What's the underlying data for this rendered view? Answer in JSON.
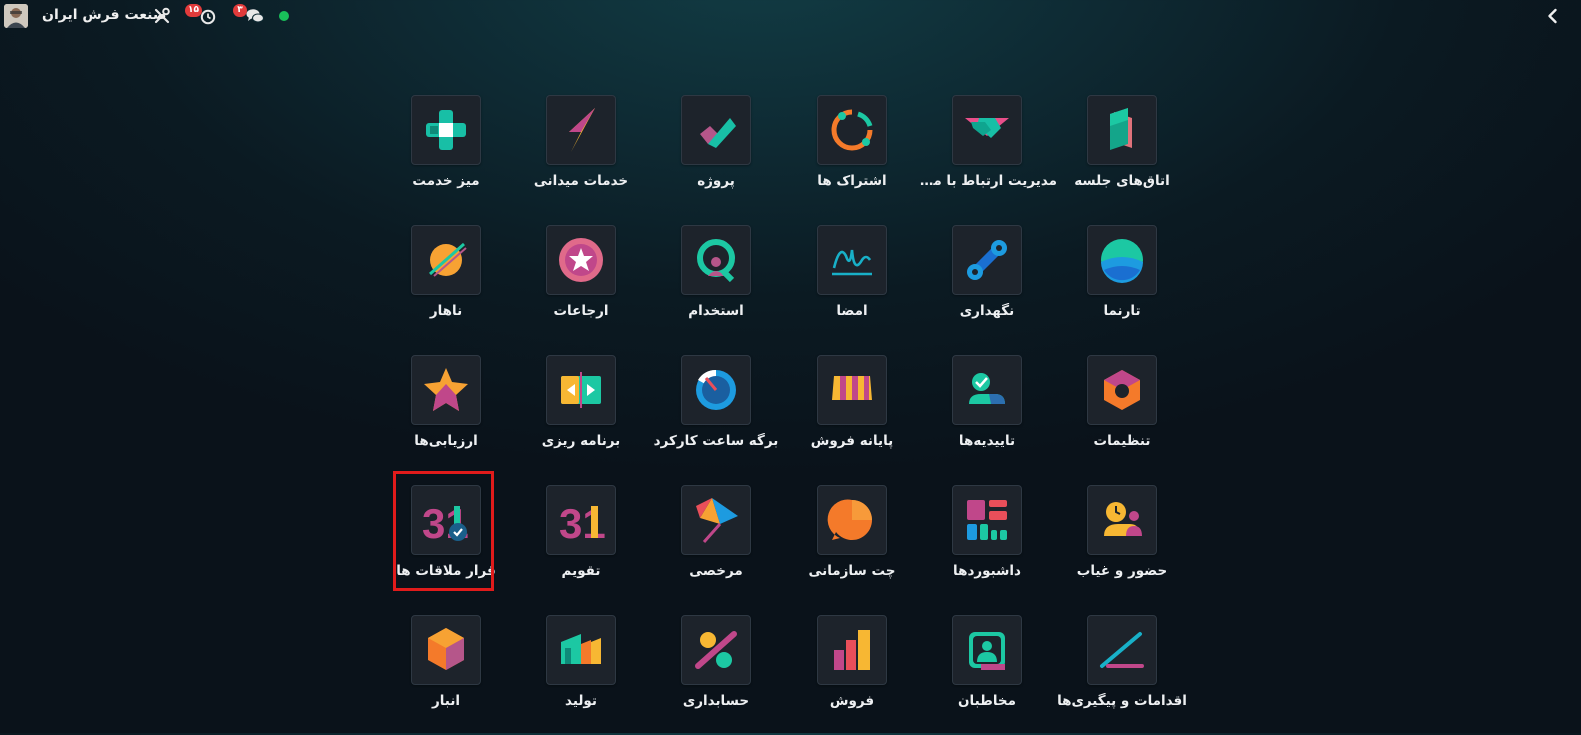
{
  "topbar": {
    "company": "صنعت فرش ایران",
    "activity_badge": "۱۵",
    "messages_badge": "۳",
    "status_color": "#19c15a"
  },
  "apps": [
    {
      "label": "اتاق‌های جلسه",
      "icon": "meeting-rooms-icon"
    },
    {
      "label": "مدیریت ارتباط با مشتری",
      "icon": "crm-icon"
    },
    {
      "label": "اشتراک ها",
      "icon": "subscriptions-icon"
    },
    {
      "label": "پروژه",
      "icon": "project-icon"
    },
    {
      "label": "خدمات میدانی",
      "icon": "field-service-icon"
    },
    {
      "label": "میز خدمت",
      "icon": "helpdesk-icon"
    },
    {
      "label": "تارنما",
      "icon": "website-icon"
    },
    {
      "label": "نگهداری",
      "icon": "maintenance-icon"
    },
    {
      "label": "امضا",
      "icon": "sign-icon"
    },
    {
      "label": "استخدام",
      "icon": "recruitment-icon"
    },
    {
      "label": "ارجاعات",
      "icon": "referrals-icon"
    },
    {
      "label": "ناهار",
      "icon": "lunch-icon"
    },
    {
      "label": "تنظیمات",
      "icon": "settings-icon"
    },
    {
      "label": "تاییدیه‌ها",
      "icon": "approvals-icon"
    },
    {
      "label": "پایانه فروش",
      "icon": "point-of-sale-icon"
    },
    {
      "label": "برگه ساعت کارکرد",
      "icon": "timesheets-icon"
    },
    {
      "label": "برنامه ریزی",
      "icon": "planning-icon"
    },
    {
      "label": "ارزیابی‌ها",
      "icon": "appraisals-icon"
    },
    {
      "label": "حضور و غیاب",
      "icon": "attendances-icon"
    },
    {
      "label": "داشبوردها",
      "icon": "dashboards-icon"
    },
    {
      "label": "چت سازمانی",
      "icon": "discuss-icon"
    },
    {
      "label": "مرخصی",
      "icon": "time-off-icon"
    },
    {
      "label": "تقویم",
      "icon": "calendar-icon",
      "icon_text": "31"
    },
    {
      "label": "قرار ملاقات ها",
      "icon": "appointments-icon",
      "icon_text": "31",
      "highlighted": true
    },
    {
      "label": "اقدامات و پیگیری‌ها",
      "icon": "activities-icon"
    },
    {
      "label": "مخاطبان",
      "icon": "contacts-icon"
    },
    {
      "label": "فروش",
      "icon": "sales-icon"
    },
    {
      "label": "حسابداری",
      "icon": "accounting-icon"
    },
    {
      "label": "تولید",
      "icon": "manufacturing-icon"
    },
    {
      "label": "انبار",
      "icon": "inventory-icon"
    }
  ]
}
